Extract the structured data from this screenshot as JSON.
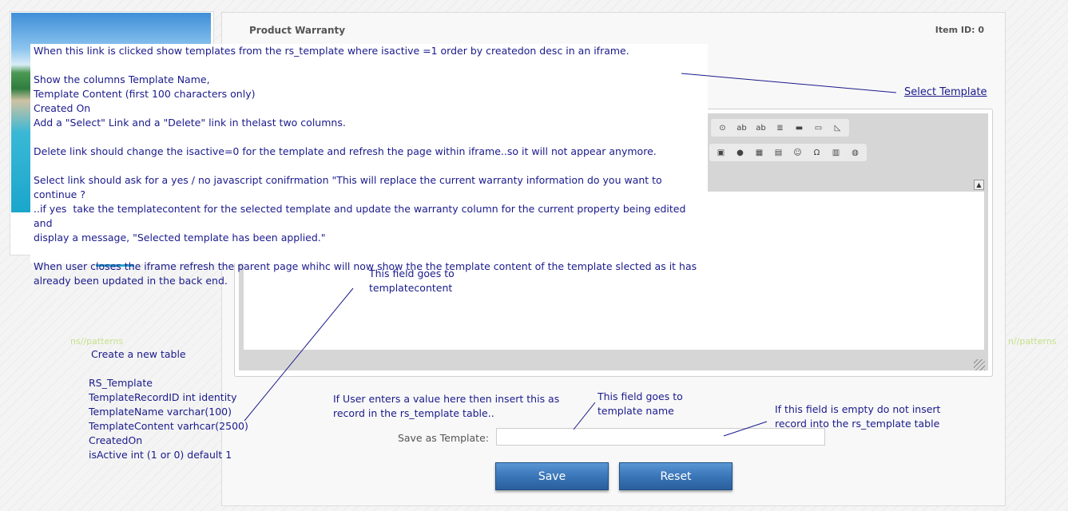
{
  "panel": {
    "title": "Product Warranty",
    "item_id": "Item ID: 0",
    "select_template_link": "Select Template"
  },
  "editor": {
    "toolbar_row_1": [
      "radio-icon",
      "textfield-icon",
      "textarea-icon",
      "list-icon",
      "horizontal-rule-icon",
      "gradient-icon",
      "triangle-icon"
    ],
    "toolbar_row_2": [
      "image-icon",
      "flash-icon",
      "table-icon",
      "separator-icon",
      "smiley-icon",
      "omega-icon",
      "pagebreak-icon",
      "globe-icon"
    ],
    "toolbar_row_1_glyphs": [
      "⊙",
      "ab",
      "ab",
      "≣",
      "▬",
      "▭",
      "◺"
    ],
    "toolbar_row_2_glyphs": [
      "▣",
      "●",
      "▦",
      "▤",
      "☺",
      "Ω",
      "▥",
      "◍"
    ]
  },
  "form": {
    "save_as_template_label": "Save as Template:",
    "save_as_template_value": "",
    "save_button": "Save",
    "reset_button": "Reset"
  },
  "annotations": {
    "main_note": [
      "When this link is clicked show templates from the rs_template where isactive =1 order by createdon desc in an iframe.",
      "",
      "Show the columns Template Name,",
      "Template Content (first 100 characters only)",
      "Created On",
      "Add a \"Select\" Link and a \"Delete\" link in thelast two columns.",
      "",
      "Delete link should change the isactive=0 for the template and refresh the page within iframe..so it will not appear anymore.",
      "",
      "Select link should ask for a yes / no javascript conifrmation \"This will replace the current warranty information do you want to continue ?",
      "..if yes  take the templatecontent for the selected template and update the warranty column for the current property being edited and",
      "display a message, \"Selected template has been applied.\"",
      "",
      "When user closes the iframe refresh the parent page whihc will now show the the template content of the template slected as it has",
      "already been updated in the back end."
    ],
    "field_templatecontent": "This field goes to\ntemplatecontent",
    "create_table": "Create a new table",
    "table_def": "RS_Template\nTemplateRecordID int identity\nTemplateName varchar(100)\nTemplateContent varhcar(2500)\nCreatedOn\nisActive int (1 or 0) default 1",
    "insert_value_note": "If User enters a value here then insert this as\nrecord in the rs_template table..",
    "field_template_name": "This field goes to\ntemplate name",
    "empty_field_note": "If this field is empty do not insert\nrecord into the rs_template table",
    "bg_watermark_left": "ns//patterns",
    "bg_watermark_right": "n//patterns"
  }
}
